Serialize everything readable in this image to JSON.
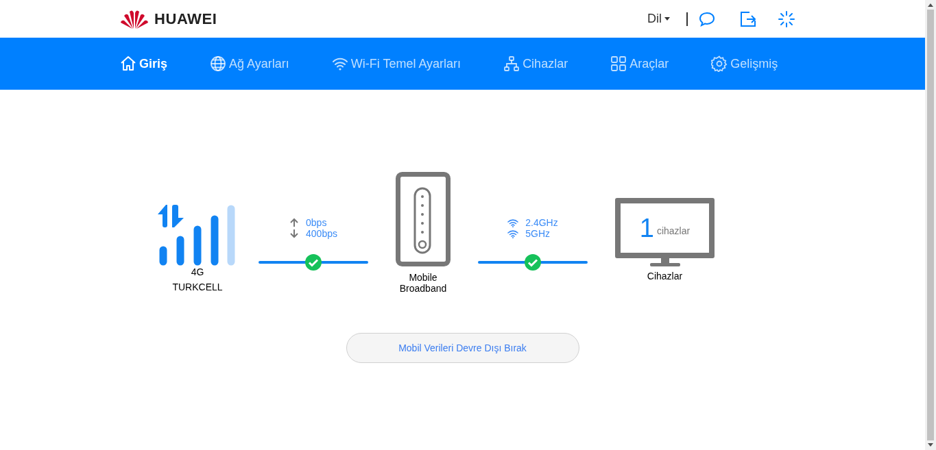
{
  "header": {
    "brand": "HUAWEI",
    "language": "Dil"
  },
  "nav": [
    {
      "label": "Giriş",
      "selected": true
    },
    {
      "label": "Ağ Ayarları",
      "selected": false
    },
    {
      "label": "Wi-Fi Temel Ayarları",
      "selected": false
    },
    {
      "label": "Cihazlar",
      "selected": false
    },
    {
      "label": "Araçlar",
      "selected": false
    },
    {
      "label": "Gelişmiş",
      "selected": false
    }
  ],
  "network": {
    "type": "4G",
    "operator": "TURKCELL"
  },
  "wan_link": {
    "connected": true,
    "upload": "0bps",
    "download": "400bps"
  },
  "router": {
    "label": "Mobile Broadband"
  },
  "wifi_link": {
    "connected": true,
    "bands": [
      "2.4GHz",
      "5GHz"
    ]
  },
  "devices": {
    "count": "1",
    "unit": "cihazlar",
    "label": "Cihazlar"
  },
  "action_button": "Mobil Verileri Devre Dışı Bırak"
}
